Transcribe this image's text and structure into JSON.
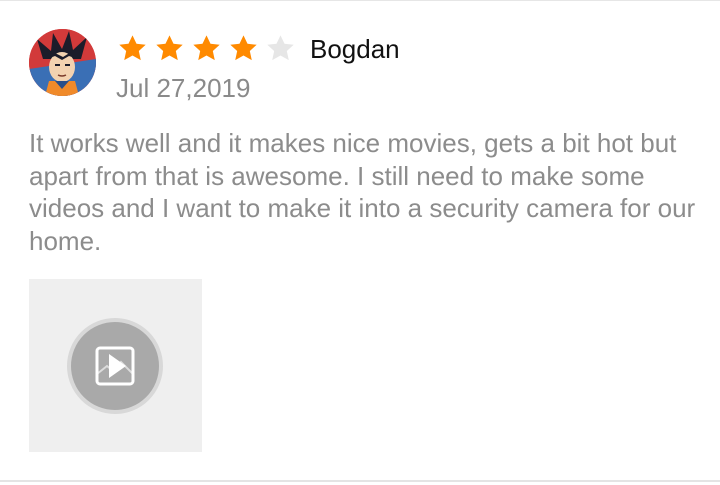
{
  "review": {
    "reviewer_name": "Bogdan",
    "date": "Jul 27,2019",
    "rating": 4,
    "max_rating": 5,
    "body": "It works well and it makes nice movies, gets a bit hot but apart from that is awesome. I still need to make some videos and I want to make it into a security camera for our home.",
    "avatar_icon": "anime-character-avatar",
    "attachment_icon": "video-play-icon"
  },
  "colors": {
    "star_filled": "#ff8a00",
    "star_empty": "#e6e6e6",
    "name_text": "#111111",
    "secondary_text": "#8c8c8c",
    "thumb_background": "#efefef",
    "play_button": "#a9a9a9"
  }
}
